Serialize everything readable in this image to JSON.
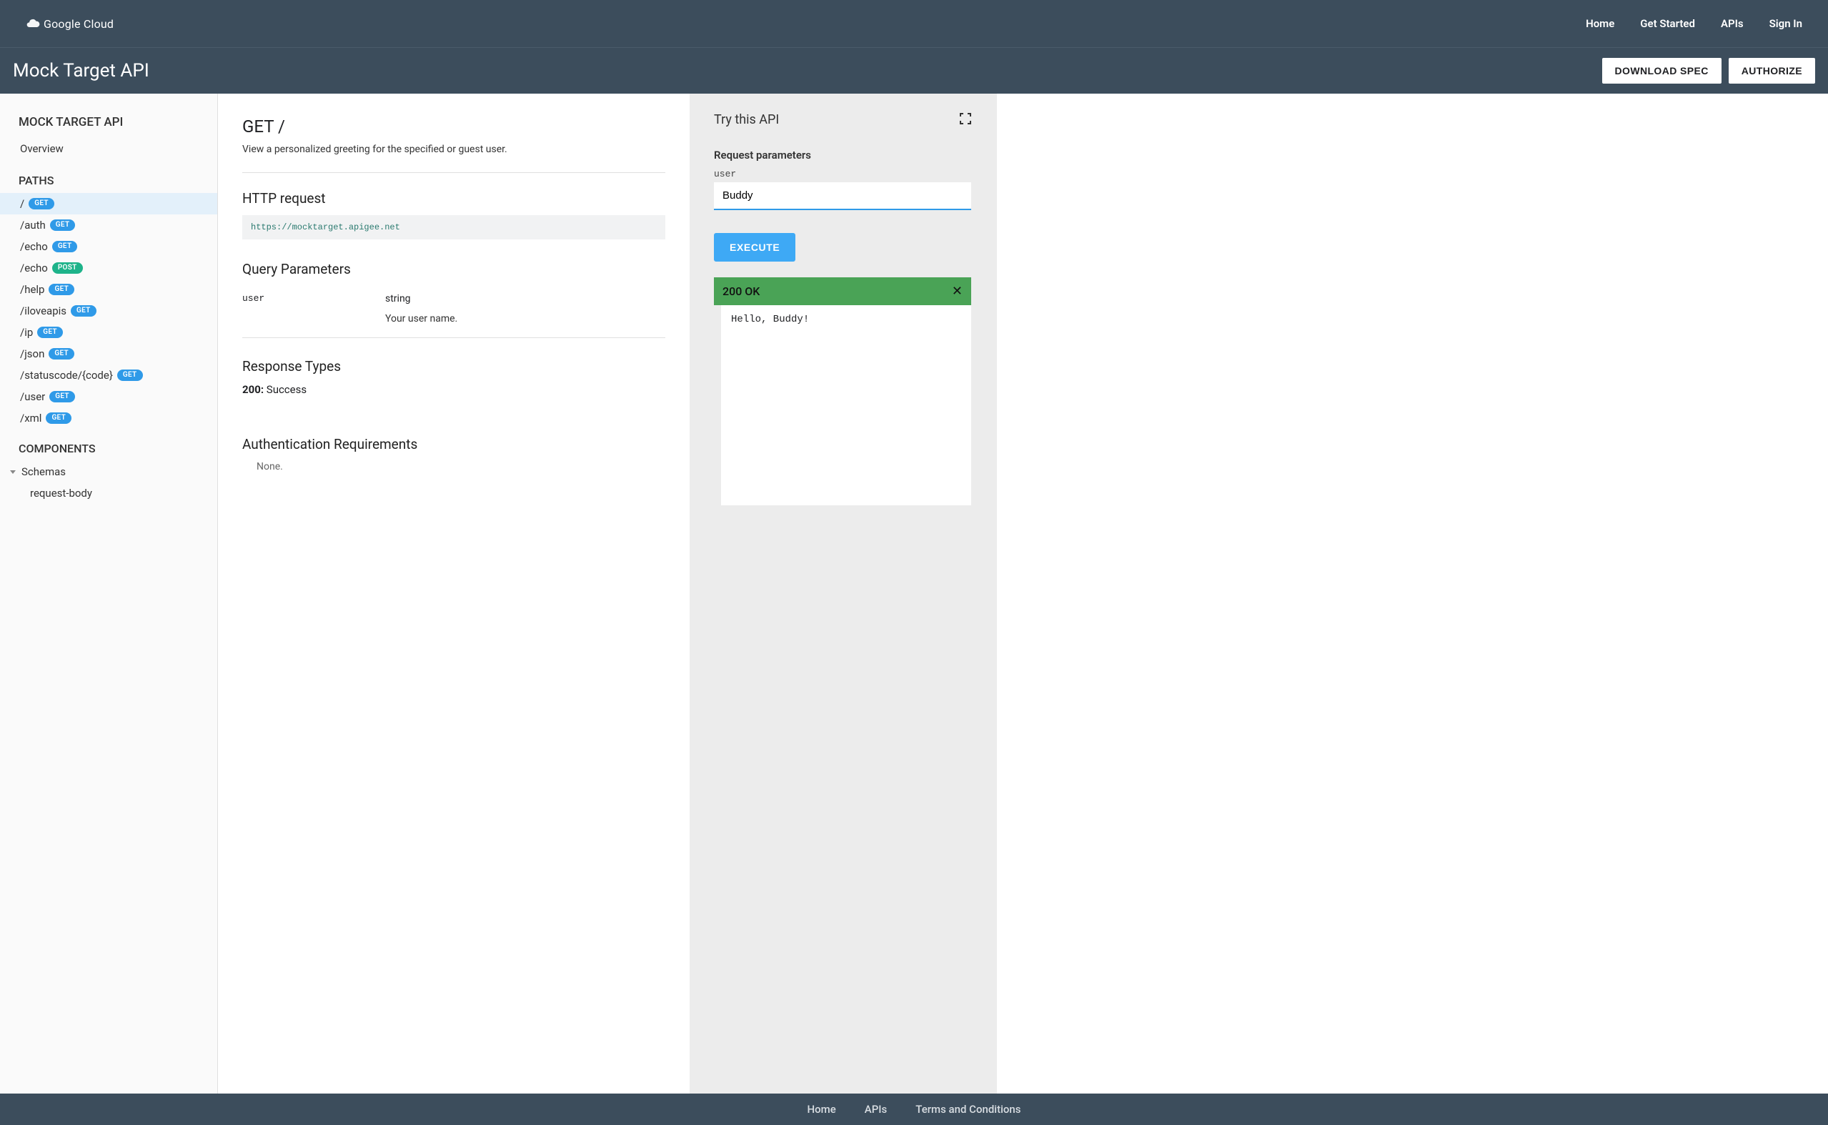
{
  "topnav": {
    "logo_text": "Google Cloud",
    "links": [
      "Home",
      "Get Started",
      "APIs",
      "Sign In"
    ]
  },
  "subheader": {
    "title": "Mock Target API",
    "download": "DOWNLOAD SPEC",
    "authorize": "AUTHORIZE"
  },
  "sidebar": {
    "api_title": "MOCK TARGET API",
    "overview": "Overview",
    "paths_label": "PATHS",
    "paths": [
      {
        "path": "/",
        "method": "GET",
        "active": true
      },
      {
        "path": "/auth",
        "method": "GET",
        "active": false
      },
      {
        "path": "/echo",
        "method": "GET",
        "active": false
      },
      {
        "path": "/echo",
        "method": "POST",
        "active": false
      },
      {
        "path": "/help",
        "method": "GET",
        "active": false
      },
      {
        "path": "/iloveapis",
        "method": "GET",
        "active": false
      },
      {
        "path": "/ip",
        "method": "GET",
        "active": false
      },
      {
        "path": "/json",
        "method": "GET",
        "active": false
      },
      {
        "path": "/statuscode/{code}",
        "method": "GET",
        "active": false
      },
      {
        "path": "/user",
        "method": "GET",
        "active": false
      },
      {
        "path": "/xml",
        "method": "GET",
        "active": false
      }
    ],
    "components_label": "COMPONENTS",
    "schemas_label": "Schemas",
    "schema_items": [
      "request-body"
    ]
  },
  "main": {
    "title": "GET /",
    "description": "View a personalized greeting for the specified or guest user.",
    "http_request_label": "HTTP request",
    "http_url": "https://mocktarget.apigee.net",
    "query_params_label": "Query Parameters",
    "query_params": [
      {
        "name": "user",
        "type": "string",
        "desc": "Your user name."
      }
    ],
    "response_types_label": "Response Types",
    "responses": [
      {
        "code": "200:",
        "desc": "Success"
      }
    ],
    "auth_label": "Authentication Requirements",
    "auth_none": "None."
  },
  "try": {
    "title": "Try this API",
    "req_params_label": "Request parameters",
    "param_name": "user",
    "param_value": "Buddy",
    "execute": "EXECUTE",
    "status": "200 OK",
    "response_body": "Hello, Buddy!"
  },
  "footer": {
    "links": [
      "Home",
      "APIs",
      "Terms and Conditions"
    ]
  }
}
